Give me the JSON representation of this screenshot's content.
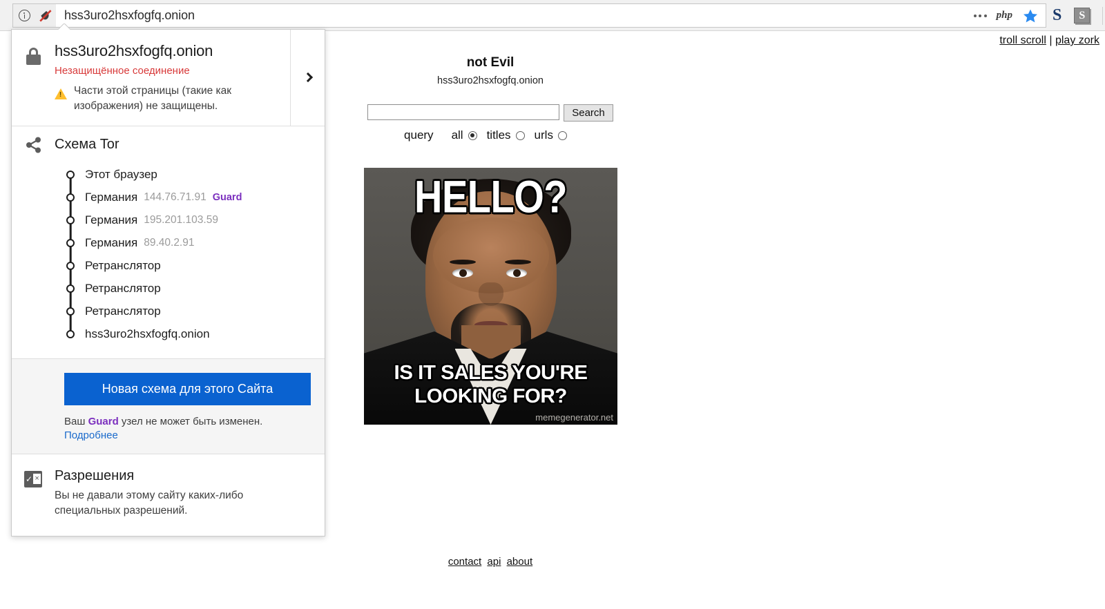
{
  "browser": {
    "url": "hss3uro2hsxfogfq.onion",
    "identity_icon": "info-circle-icon",
    "mixed_content_icon": "shield-slash-icon",
    "toolbar_icons": [
      "more-dots-icon",
      "php-badge-icon",
      "bookmark-star-icon",
      "s-letter-icon",
      "s-box-icon",
      "hamburger-menu-icon"
    ],
    "php_label": "php"
  },
  "identity_panel": {
    "host": "hss3uro2hsxfogfq.onion",
    "connection_status": "Незащищённое соединение",
    "mixed_content_warning": "Части этой страницы (такие как изображения) не защищены.",
    "expand_icon": "chevron-right-icon",
    "lock_icon": "lock-icon",
    "warning_icon": "warning-triangle-icon",
    "circuit": {
      "title": "Схема Tor",
      "icon": "tor-circuit-icon",
      "nodes": [
        {
          "label": "Этот браузер",
          "ip": "",
          "tag": ""
        },
        {
          "label": "Германия",
          "ip": "144.76.71.91",
          "tag": "Guard"
        },
        {
          "label": "Германия",
          "ip": "195.201.103.59",
          "tag": ""
        },
        {
          "label": "Германия",
          "ip": "89.40.2.91",
          "tag": ""
        },
        {
          "label": "Ретранслятор",
          "ip": "",
          "tag": ""
        },
        {
          "label": "Ретранслятор",
          "ip": "",
          "tag": ""
        },
        {
          "label": "Ретранслятор",
          "ip": "",
          "tag": ""
        },
        {
          "label": "hss3uro2hsxfogfq.onion",
          "ip": "",
          "tag": ""
        }
      ]
    },
    "new_circuit_button": "Новая схема для этого Сайта",
    "guard_note_prefix": "Ваш ",
    "guard_note_bold": "Guard",
    "guard_note_suffix": " узел не может быть изменен.",
    "guard_more_link": "Подробнее",
    "permissions": {
      "icon": "permissions-icon",
      "title": "Разрешения",
      "description": "Вы не давали этому сайту каких-либо специальных разрешений."
    }
  },
  "page": {
    "top_links": {
      "troll": "troll scroll",
      "separator": "|",
      "zork": "play zork"
    },
    "site_title": "not Evil",
    "site_subtitle": "hss3uro2hsxfogfq.onion",
    "search": {
      "value": "",
      "placeholder": "",
      "button_label": "Search"
    },
    "scope": {
      "query_label": "query",
      "options": [
        {
          "label": "all",
          "selected": true
        },
        {
          "label": "titles",
          "selected": false
        },
        {
          "label": "urls",
          "selected": false
        }
      ]
    },
    "meme": {
      "top_text": "HELLO?",
      "bottom_text": "IS IT SALES YOU'RE LOOKING FOR?",
      "watermark": "memegenerator.net"
    },
    "footer_links": [
      "contact",
      "api",
      "about"
    ]
  },
  "colors": {
    "accent_blue": "#0a62d0",
    "insecure_red": "#d83a3a",
    "guard_purple": "#7b2fbe",
    "link_blue": "#1a6acb",
    "warning_yellow": "#ffbf2e"
  }
}
